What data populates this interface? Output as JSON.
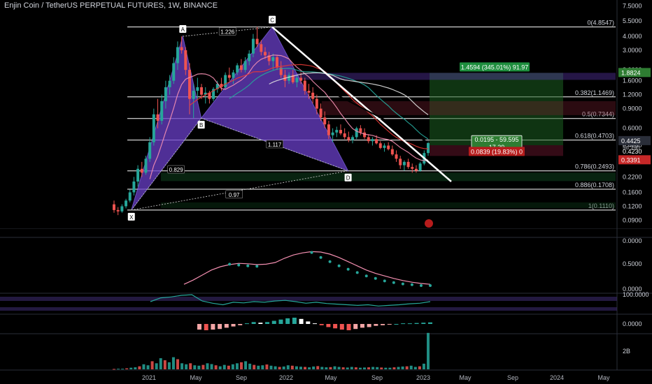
{
  "header": {
    "title": "Enjin Coin / TetherUS PERPETUAL FUTURES, 1W, BINANCE"
  },
  "colors": {
    "background": "#000000",
    "harmonic_fill": "#6a3fc8",
    "fib_line": "#ffffff",
    "long_profit_zone": "#1b5e20",
    "loss_zone": "#4a1020",
    "bull_candle": "#26a69a",
    "bear_candle": "#ef5350",
    "ma_red": "#e53935",
    "ma_green": "#26a69a",
    "ma_pink": "#f48fb1",
    "ma_white": "#e0e0e0",
    "panel_separator": "#2a2e39"
  },
  "chart_data": [
    {
      "type": "candlestick",
      "title": "Enjin Coin / TetherUS PERPETUAL FUTURES, 1W, BINANCE",
      "y_scale": "log",
      "y_ticks": [
        "7.5000",
        "5.5000",
        "4.0000",
        "3.0000",
        "2.0000",
        "1.6000",
        "1.2000",
        "0.9000",
        "0.6000",
        "0.4230",
        "0.3000",
        "0.2200",
        "0.1600",
        "0.1200",
        "0.0900"
      ],
      "x_ticks": [
        "2021",
        "May",
        "Sep",
        "2022",
        "May",
        "Sep",
        "2023",
        "May",
        "Sep",
        "2024",
        "May"
      ],
      "price_labels": [
        {
          "text": "1.8824",
          "kind": "profit-target"
        },
        {
          "text": "0.4425",
          "kind": "last-price"
        },
        {
          "text": "5d 19h",
          "kind": "countdown"
        },
        {
          "text": "0.4230",
          "kind": "entry"
        },
        {
          "text": "0.3391",
          "kind": "stop"
        }
      ],
      "fib_levels": [
        {
          "label": "0(4.8547)",
          "price": 4.8547
        },
        {
          "label": "0.382(1.1469)",
          "price": 1.1469
        },
        {
          "label": "0.5(0.7344)",
          "price": 0.7344
        },
        {
          "label": "0.618(0.4703)",
          "price": 0.4703
        },
        {
          "label": "0.786(0.2493)",
          "price": 0.2493
        },
        {
          "label": "0.886(0.1708)",
          "price": 0.1708
        },
        {
          "label": "1(0.1110)",
          "price": 0.111
        }
      ],
      "harmonic_pattern": {
        "points": [
          {
            "label": "X",
            "date": "2020-11-15",
            "price": 0.111
          },
          {
            "label": "A",
            "date": "2021-04-01",
            "price": 4.0
          },
          {
            "label": "B",
            "date": "2021-05-20",
            "price": 0.74
          },
          {
            "label": "C",
            "date": "2021-11-25",
            "price": 4.85
          },
          {
            "label": "D",
            "date": "2022-06-15",
            "price": 0.2493
          }
        ],
        "ratios": [
          "1.226",
          "0.829",
          "1.117",
          "0.97"
        ]
      },
      "position_tool": {
        "target_label": "1.4594 (345.01%) 91.97",
        "entry_label": "0.0195 - 59.595",
        "entry_label_sub": "17.39",
        "stop_label": "0.0839 (19.83%) 0",
        "target_price": 1.8824,
        "entry_price": 0.423,
        "stop_price": 0.3391
      },
      "ohlc_weekly": [
        [
          0.125,
          0.135,
          0.105,
          0.111
        ],
        [
          0.111,
          0.118,
          0.1,
          0.108
        ],
        [
          0.108,
          0.125,
          0.105,
          0.12
        ],
        [
          0.12,
          0.14,
          0.115,
          0.135
        ],
        [
          0.135,
          0.17,
          0.13,
          0.16
        ],
        [
          0.16,
          0.22,
          0.15,
          0.2
        ],
        [
          0.2,
          0.28,
          0.18,
          0.26
        ],
        [
          0.26,
          0.3,
          0.22,
          0.24
        ],
        [
          0.24,
          0.34,
          0.23,
          0.32
        ],
        [
          0.32,
          0.5,
          0.3,
          0.45
        ],
        [
          0.45,
          0.9,
          0.42,
          0.8
        ],
        [
          0.8,
          1.1,
          0.6,
          0.7
        ],
        [
          0.7,
          1.2,
          0.65,
          1.05
        ],
        [
          1.05,
          1.6,
          0.9,
          1.4
        ],
        [
          1.4,
          1.8,
          1.2,
          1.6
        ],
        [
          1.6,
          2.6,
          1.5,
          2.3
        ],
        [
          2.3,
          3.6,
          2.0,
          3.2
        ],
        [
          3.2,
          4.0,
          2.8,
          3.0
        ],
        [
          3.0,
          3.2,
          1.8,
          2.0
        ],
        [
          2.0,
          2.3,
          0.8,
          1.1
        ],
        [
          1.1,
          1.5,
          0.74,
          1.3
        ],
        [
          1.3,
          1.7,
          1.1,
          1.4
        ],
        [
          1.4,
          1.5,
          1.1,
          1.2
        ],
        [
          1.2,
          1.4,
          1.0,
          1.25
        ],
        [
          1.25,
          1.3,
          1.0,
          1.1
        ],
        [
          1.1,
          1.4,
          1.05,
          1.35
        ],
        [
          1.35,
          1.6,
          1.25,
          1.5
        ],
        [
          1.5,
          1.7,
          1.3,
          1.4
        ],
        [
          1.4,
          1.9,
          1.35,
          1.8
        ],
        [
          1.8,
          2.1,
          1.6,
          1.7
        ],
        [
          1.7,
          2.0,
          1.5,
          1.9
        ],
        [
          1.9,
          2.3,
          1.8,
          2.2
        ],
        [
          2.2,
          2.5,
          1.9,
          2.0
        ],
        [
          2.0,
          2.6,
          1.9,
          2.4
        ],
        [
          2.4,
          3.0,
          2.2,
          2.8
        ],
        [
          2.8,
          4.2,
          2.6,
          3.8
        ],
        [
          3.8,
          4.85,
          3.2,
          3.4
        ],
        [
          3.4,
          3.7,
          2.7,
          2.9
        ],
        [
          2.9,
          3.2,
          2.5,
          2.7
        ],
        [
          2.7,
          2.9,
          2.2,
          2.4
        ],
        [
          2.4,
          2.8,
          2.0,
          2.6
        ],
        [
          2.6,
          2.7,
          2.0,
          2.1
        ],
        [
          2.1,
          2.4,
          1.7,
          1.8
        ],
        [
          1.8,
          2.0,
          1.4,
          1.6
        ],
        [
          1.6,
          1.9,
          1.5,
          1.8
        ],
        [
          1.8,
          2.0,
          1.5,
          1.55
        ],
        [
          1.55,
          1.8,
          1.4,
          1.7
        ],
        [
          1.7,
          1.9,
          1.5,
          1.6
        ],
        [
          1.6,
          1.7,
          1.2,
          1.3
        ],
        [
          1.3,
          1.5,
          1.1,
          1.25
        ],
        [
          1.25,
          1.4,
          1.0,
          1.1
        ],
        [
          1.1,
          1.2,
          0.8,
          0.9
        ],
        [
          0.9,
          1.0,
          0.7,
          0.75
        ],
        [
          0.75,
          0.85,
          0.6,
          0.65
        ],
        [
          0.65,
          0.7,
          0.48,
          0.52
        ],
        [
          0.52,
          0.6,
          0.45,
          0.55
        ],
        [
          0.55,
          0.62,
          0.5,
          0.58
        ],
        [
          0.58,
          0.65,
          0.52,
          0.54
        ],
        [
          0.54,
          0.6,
          0.48,
          0.5
        ],
        [
          0.5,
          0.56,
          0.45,
          0.47
        ],
        [
          0.47,
          0.52,
          0.44,
          0.5
        ],
        [
          0.5,
          0.62,
          0.48,
          0.6
        ],
        [
          0.6,
          0.64,
          0.52,
          0.55
        ],
        [
          0.55,
          0.6,
          0.48,
          0.5
        ],
        [
          0.5,
          0.53,
          0.44,
          0.46
        ],
        [
          0.46,
          0.5,
          0.42,
          0.48
        ],
        [
          0.48,
          0.52,
          0.43,
          0.44
        ],
        [
          0.44,
          0.46,
          0.39,
          0.4
        ],
        [
          0.4,
          0.44,
          0.37,
          0.42
        ],
        [
          0.42,
          0.45,
          0.38,
          0.39
        ],
        [
          0.39,
          0.42,
          0.34,
          0.35
        ],
        [
          0.35,
          0.38,
          0.3,
          0.32
        ],
        [
          0.32,
          0.34,
          0.26,
          0.28
        ],
        [
          0.28,
          0.31,
          0.25,
          0.3
        ],
        [
          0.3,
          0.32,
          0.26,
          0.27
        ],
        [
          0.27,
          0.29,
          0.24,
          0.26
        ],
        [
          0.26,
          0.28,
          0.24,
          0.25
        ],
        [
          0.25,
          0.3,
          0.245,
          0.29
        ],
        [
          0.29,
          0.38,
          0.28,
          0.36
        ],
        [
          0.36,
          0.46,
          0.34,
          0.443
        ]
      ]
    },
    {
      "type": "line",
      "title": "",
      "y_ticks": [
        "0.0000",
        "0.5000",
        "0.0000"
      ],
      "series": [
        {
          "color_key": "ma_pink",
          "values": [
            0.08,
            0.18,
            0.3,
            0.42,
            0.5,
            0.55,
            0.58,
            0.57,
            0.55,
            0.56,
            0.6,
            0.7,
            0.78,
            0.83,
            0.86,
            0.85,
            0.8,
            0.72,
            0.62,
            0.52,
            0.42,
            0.34,
            0.28,
            0.22,
            0.17,
            0.13,
            0.1,
            0.08
          ]
        },
        {
          "color_key": "ma_green",
          "dotted": true,
          "values": [
            null,
            null,
            null,
            null,
            null,
            0.56,
            0.54,
            0.52,
            0.51,
            null,
            null,
            null,
            null,
            null,
            0.84,
            0.72,
            0.62,
            0.52,
            0.44,
            0.36,
            0.28,
            0.22,
            0.16,
            0.12,
            0.09,
            0.07,
            0.05,
            0.05
          ]
        }
      ]
    },
    {
      "type": "line",
      "title": "",
      "y_ticks": [
        "100.0000"
      ],
      "series": [
        {
          "color_key": "ma_green",
          "values": [
            40,
            52,
            55,
            60,
            62,
            42,
            35,
            30,
            38,
            36,
            40,
            38,
            42,
            44,
            40,
            35,
            38,
            34,
            32,
            30,
            28,
            30,
            26,
            28,
            30,
            33,
            35,
            40
          ]
        }
      ]
    },
    {
      "type": "bar",
      "title": "",
      "y_ticks": [
        "0.0000"
      ],
      "values": [
        -0.9,
        -1.0,
        -0.9,
        -0.8,
        -0.6,
        -0.4,
        -0.2,
        0.1,
        0.3,
        0.2,
        0.3,
        0.5,
        0.7,
        0.9,
        1.0,
        0.8,
        0.4,
        0.1,
        -0.2,
        -0.5,
        -0.7,
        -0.9,
        -1.0,
        -0.8,
        -0.6,
        -0.5,
        -0.3,
        -0.2,
        -0.1,
        0.0,
        0.1,
        0.1,
        0.15,
        0.2,
        0.25
      ]
    },
    {
      "type": "bar",
      "title": "",
      "y_ticks": [
        "2B"
      ],
      "values": [
        0.02,
        0.03,
        0.03,
        0.05,
        0.08,
        0.1,
        0.15,
        0.25,
        0.2,
        0.4,
        0.3,
        0.55,
        0.45,
        0.35,
        0.6,
        0.5,
        0.3,
        0.25,
        0.3,
        0.2,
        0.18,
        0.22,
        0.3,
        0.26,
        0.2,
        0.15,
        0.22,
        0.18,
        0.25,
        0.3,
        0.35,
        0.4,
        0.28,
        0.22,
        0.18,
        0.2,
        0.24,
        0.18,
        0.15,
        0.12,
        0.14,
        0.2,
        0.18,
        0.15,
        0.13,
        0.12,
        0.1,
        0.14,
        0.16,
        0.12,
        0.1,
        0.11,
        0.15,
        0.12,
        0.1,
        0.09,
        0.12,
        0.1,
        0.08,
        0.09,
        0.1,
        0.12,
        0.11,
        0.09,
        0.08,
        0.08,
        0.1,
        0.12,
        0.14,
        0.15,
        0.18,
        0.12,
        0.15,
        0.28,
        1.8
      ]
    }
  ]
}
